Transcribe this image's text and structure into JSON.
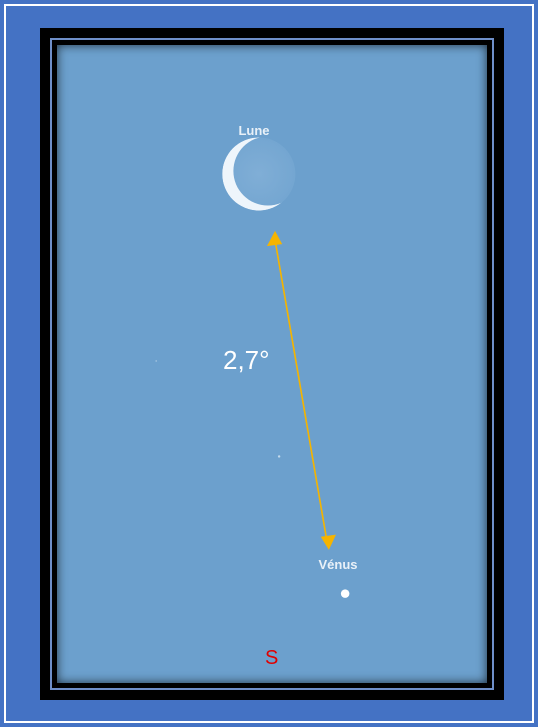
{
  "objects": {
    "moon_label": "Lune",
    "venus_label": "Vénus"
  },
  "separation": {
    "label": "2,7°"
  },
  "direction": {
    "south_label": "S"
  },
  "colors": {
    "background": "#4472c4",
    "sky": "#6ca0cd",
    "arrow": "#f5b400",
    "south": "#e00000"
  }
}
